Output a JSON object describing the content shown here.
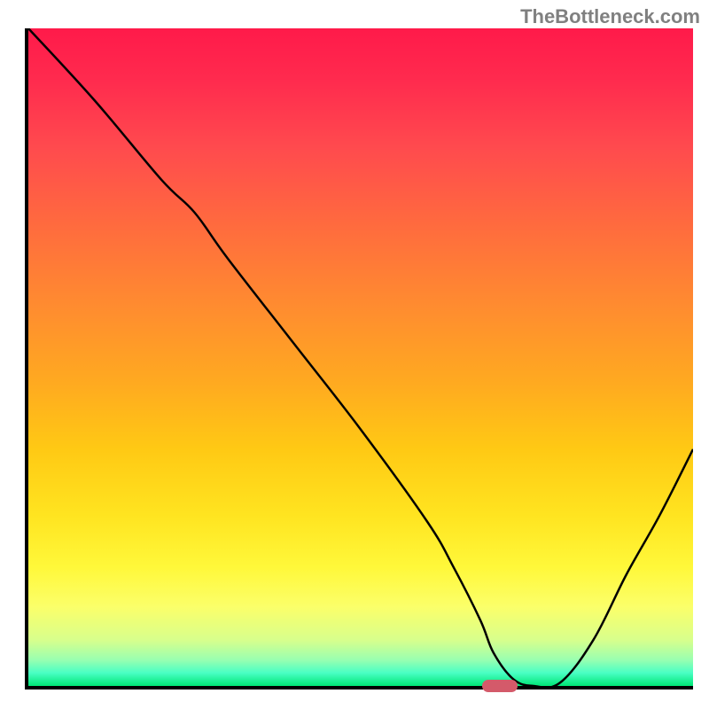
{
  "watermark": "TheBottleneck.com",
  "chart_data": {
    "type": "line",
    "title": "",
    "xlabel": "",
    "ylabel": "",
    "xlim": [
      0,
      100
    ],
    "ylim": [
      0,
      100
    ],
    "x": [
      0,
      10,
      20,
      25,
      30,
      40,
      50,
      60,
      64,
      68,
      70,
      73,
      76,
      80,
      85,
      90,
      95,
      100
    ],
    "values": [
      100,
      89,
      77,
      72,
      65,
      52,
      39,
      25,
      18,
      10,
      5,
      1,
      0,
      0.5,
      7,
      17,
      26,
      36
    ],
    "marker": {
      "x": 70.5,
      "y": 0.6
    },
    "background_gradient": {
      "type": "vertical",
      "stops": [
        {
          "pos": 0,
          "color": "#ff1a4a"
        },
        {
          "pos": 50,
          "color": "#ffaa20"
        },
        {
          "pos": 85,
          "color": "#fff83a"
        },
        {
          "pos": 100,
          "color": "#00e676"
        }
      ]
    }
  }
}
